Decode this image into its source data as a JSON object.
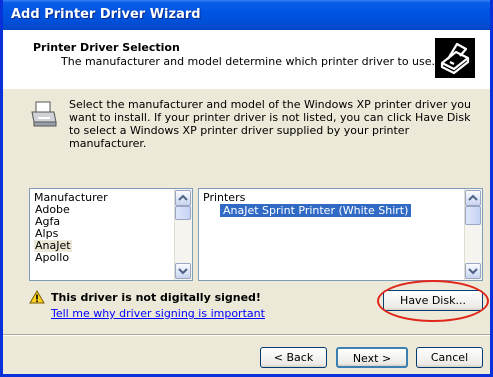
{
  "window": {
    "title": "Add Printer Driver Wizard"
  },
  "header": {
    "title": "Printer Driver Selection",
    "subtitle": "The manufacturer and model determine which printer driver to use."
  },
  "instructions": "Select the manufacturer and model of the Windows XP printer driver you want to install.  If your printer driver is not listed, you can click Have Disk to select a Windows XP printer driver supplied by your printer manufacturer.",
  "manufacturer_list": {
    "header": "Manufacturer",
    "items": [
      "Adobe",
      "Agfa",
      "Alps",
      "AnaJet",
      "Apollo"
    ],
    "selected": "AnaJet"
  },
  "printers_list": {
    "header": "Printers",
    "items": [
      "AnaJet Sprint Printer (White Shirt)"
    ],
    "selected": "AnaJet Sprint Printer (White Shirt)"
  },
  "signing": {
    "warning": "This driver is not digitally signed!",
    "link": "Tell me why driver signing is important"
  },
  "buttons": {
    "have_disk": "Have Disk...",
    "back": "< Back",
    "next": "Next >",
    "cancel": "Cancel"
  },
  "colors": {
    "titlebar": "#0054e3",
    "selection": "#316ac5",
    "highlight_ellipse": "#e0261b"
  }
}
